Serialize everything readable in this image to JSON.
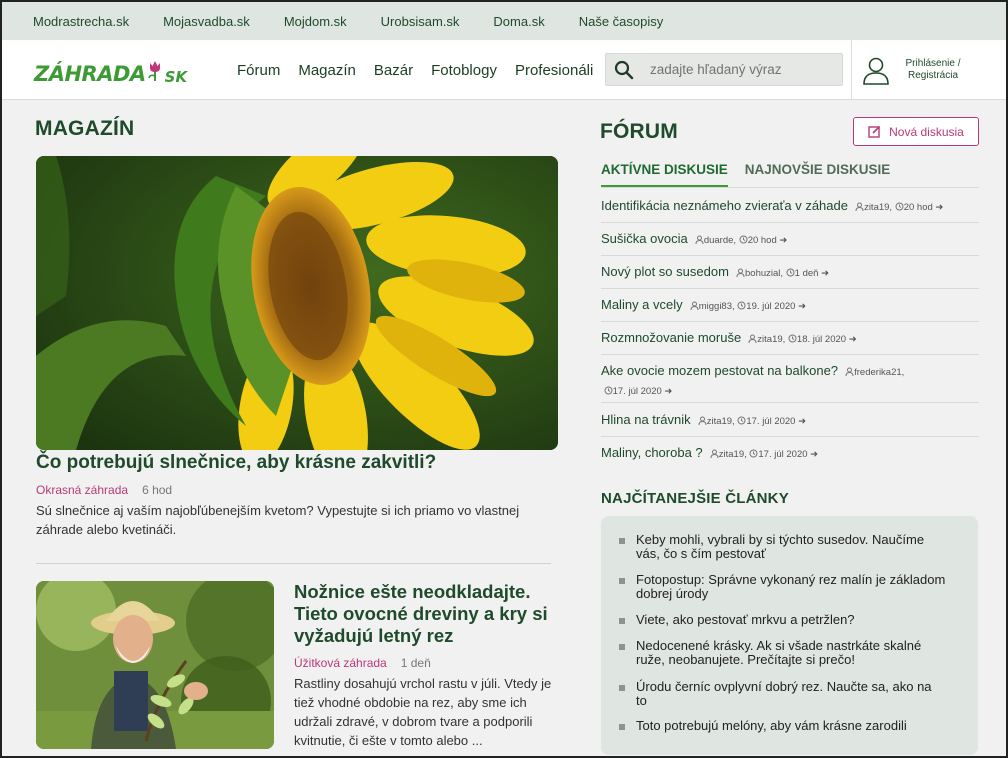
{
  "network": {
    "links": [
      "Modrastrecha.sk",
      "Mojasvadba.sk",
      "Mojdom.sk",
      "Urobsisam.sk",
      "Doma.sk",
      "Naše časopisy"
    ]
  },
  "header": {
    "logo_text": "ZÁHRADA",
    "logo_suffix": "SK",
    "nav": [
      "Fórum",
      "Magazín",
      "Bazár",
      "Fotoblogy",
      "Profesionáli"
    ],
    "search_placeholder": "zadajte hľadaný výraz",
    "login_line1": "Prihlásenie /",
    "login_line2": "Registrácia"
  },
  "magazine": {
    "title": "MAGAZÍN",
    "featured": {
      "title": "Čo potrebujú slnečnice, aby krásne zakvitli?",
      "category": "Okrasná záhrada",
      "time": "6 hod",
      "excerpt_line1": "Sú slnečnice aj vaším najobľúbenejším kvetom? Vypestujte si ich priamo vo vlastnej",
      "excerpt_line2": "záhrade alebo kvetináči."
    },
    "second": {
      "title_line1": "Nožnice ešte neodkladajte.",
      "title_line2": "Tieto ovocné dreviny a kry si",
      "title_line3": "vyžadujú letný rez",
      "category": "Úžitková záhrada",
      "time": "1 deň",
      "excerpt_line1": "Rastliny dosahujú vrchol rastu v júli. Vtedy je",
      "excerpt_line2": "tiež vhodné obdobie na rez, aby sme ich",
      "excerpt_line3": "udržali zdravé, v dobrom tvare a podporili",
      "excerpt_line4": "kvitnutie, či ešte v tomto alebo ..."
    }
  },
  "forum": {
    "title": "FÓRUM",
    "new_button": "Nová diskusia",
    "tabs": [
      "AKTÍVNE DISKUSIE",
      "NAJNOVŠIE DISKUSIE"
    ],
    "discussions": [
      {
        "title": "Identifikácia neznámeho zvieraťa v záhade",
        "user": "zita19,",
        "time": "20 hod"
      },
      {
        "title": "Sušička ovocia",
        "user": "duarde,",
        "time": "20 hod"
      },
      {
        "title": "Nový plot so susedom",
        "user": "bohuzial,",
        "time": "1 deň"
      },
      {
        "title": "Maliny a vcely",
        "user": "miggi83,",
        "time": "19. júl 2020"
      },
      {
        "title": "Rozmnožovanie moruše",
        "user": "zita19,",
        "time": "18. júl 2020"
      },
      {
        "title": "Ake ovocie mozem pestovat na balkone?",
        "user": "frederika21,",
        "time": "17. júl 2020"
      },
      {
        "title": "Hlina na trávnik",
        "user": "zita19,",
        "time": "17. júl 2020"
      },
      {
        "title": "Maliny, choroba ?",
        "user": "zita19,",
        "time": "17. júl 2020"
      }
    ]
  },
  "top_articles": {
    "title": "NAJČÍTANEJŠIE ČLÁNKY",
    "items": [
      {
        "l1": "Keby mohli, vybrali by si týchto susedov. Naučíme",
        "l2": "vás, čo s čím pestovať"
      },
      {
        "l1": "Fotopostup: Správne vykonaný rez malín je základom",
        "l2": "dobrej úrody"
      },
      {
        "l1": "Viete, ako pestovať mrkvu a petržlen?",
        "l2": ""
      },
      {
        "l1": "Nedocenené krásky. Ak si všade nastrkáte skalné",
        "l2": "ruže, neobanujete. Prečítajte si prečo!"
      },
      {
        "l1": "Úrodu černíc ovplyvní dobrý rez. Naučte sa, ako na",
        "l2": "to"
      },
      {
        "l1": "Toto potrebujú melóny, aby vám krásne zarodili",
        "l2": ""
      }
    ]
  },
  "colors": {
    "brand_green": "#3d9a35",
    "dark_green": "#1f4a2c",
    "accent_pink": "#b73a76"
  }
}
